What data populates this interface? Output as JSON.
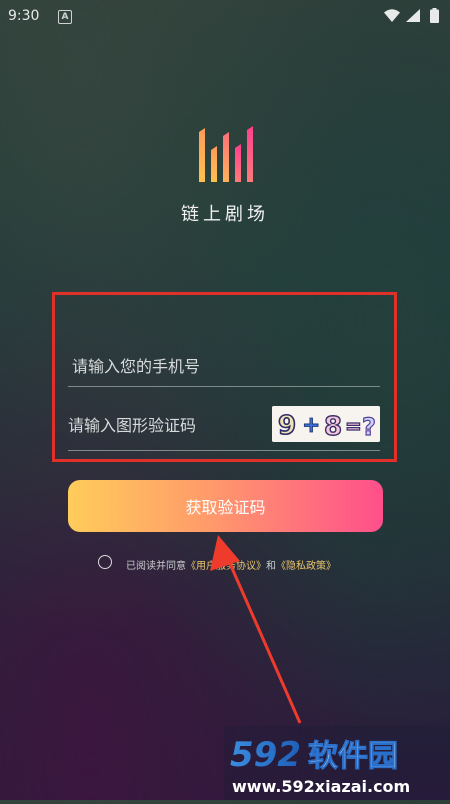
{
  "status": {
    "time": "9:30",
    "notification_glyph": "A"
  },
  "app": {
    "name": "链上剧场"
  },
  "form": {
    "phone_placeholder": "请输入您的手机号",
    "captcha_placeholder": "请输入图形验证码",
    "captcha_image_text": "9 + 8 = ?",
    "submit_label": "获取验证码"
  },
  "agreement": {
    "prefix": "已阅读并同意",
    "user_agreement": "《用户服务协议》",
    "and": "和",
    "privacy_policy": "《隐私政策》"
  },
  "watermark": {
    "brand": "592软件园",
    "url": "www.592xiazai.com"
  },
  "colors": {
    "button_start": "#ffcc5a",
    "button_end": "#ff4f8b",
    "annotation_red": "#e0302a",
    "link": "#e9c46a"
  }
}
